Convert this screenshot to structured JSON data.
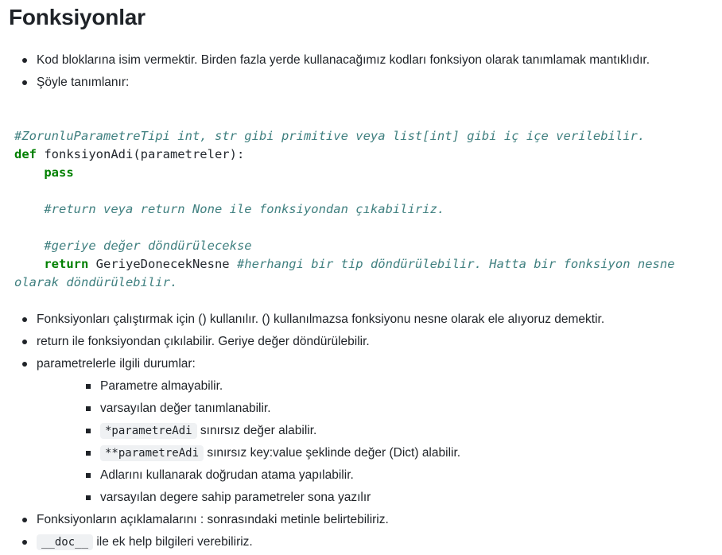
{
  "heading": "Fonksiyonlar",
  "intro": [
    "Kod bloklarına isim vermektir. Birden fazla yerde kullanacağımız kodları fonksiyon olarak tanımlamak mantıklıdır.",
    "Şöyle tanımlanır:"
  ],
  "code": {
    "c1": "#ZorunluParametreTipi int, str gibi primitive veya list[int] gibi iç içe verilebilir.",
    "def_kw": "def",
    "def_rest": " fonksiyonAdi(parametreler):",
    "pass_kw": "pass",
    "c2": "#return veya return None ile fonksiyondan çıkabiliriz.",
    "c3": "#geriye değer döndürülecekse",
    "return_kw": "return",
    "return_val": " GeriyeDonecekNesne ",
    "c4": "#herhangi bir tip döndürülebilir. Hatta bir fonksiyon nesne olarak döndürülebilir."
  },
  "list2": [
    "Fonksiyonları çalıştırmak için () kullanılır. () kullanılmazsa fonksiyonu nesne olarak ele alıyoruz demektir.",
    "return ile fonksiyondan çıkılabilir. Geriye değer döndürülebilir.",
    "parametrelerle ilgili durumlar:"
  ],
  "sub": {
    "s1": "Parametre almayabilir.",
    "s2": "varsayılan değer tanımlanabilir.",
    "s3_code": "*parametreAdi",
    "s3_text": " sınırsız değer alabilir.",
    "s4_code": "**parametreAdi",
    "s4_text": " sınırsız key:value şeklinde değer (Dict) alabilir.",
    "s5": "Adlarını kullanarak doğrudan atama yapılabilir.",
    "s6": "varsayılan degere sahip parametreler sona yazılır"
  },
  "list3": {
    "l1": "Fonksiyonların açıklamalarını : sonrasındaki metinle belirtebiliriz.",
    "l2_code": "__doc__",
    "l2_text": " ile ek help bilgileri verebiliriz."
  }
}
